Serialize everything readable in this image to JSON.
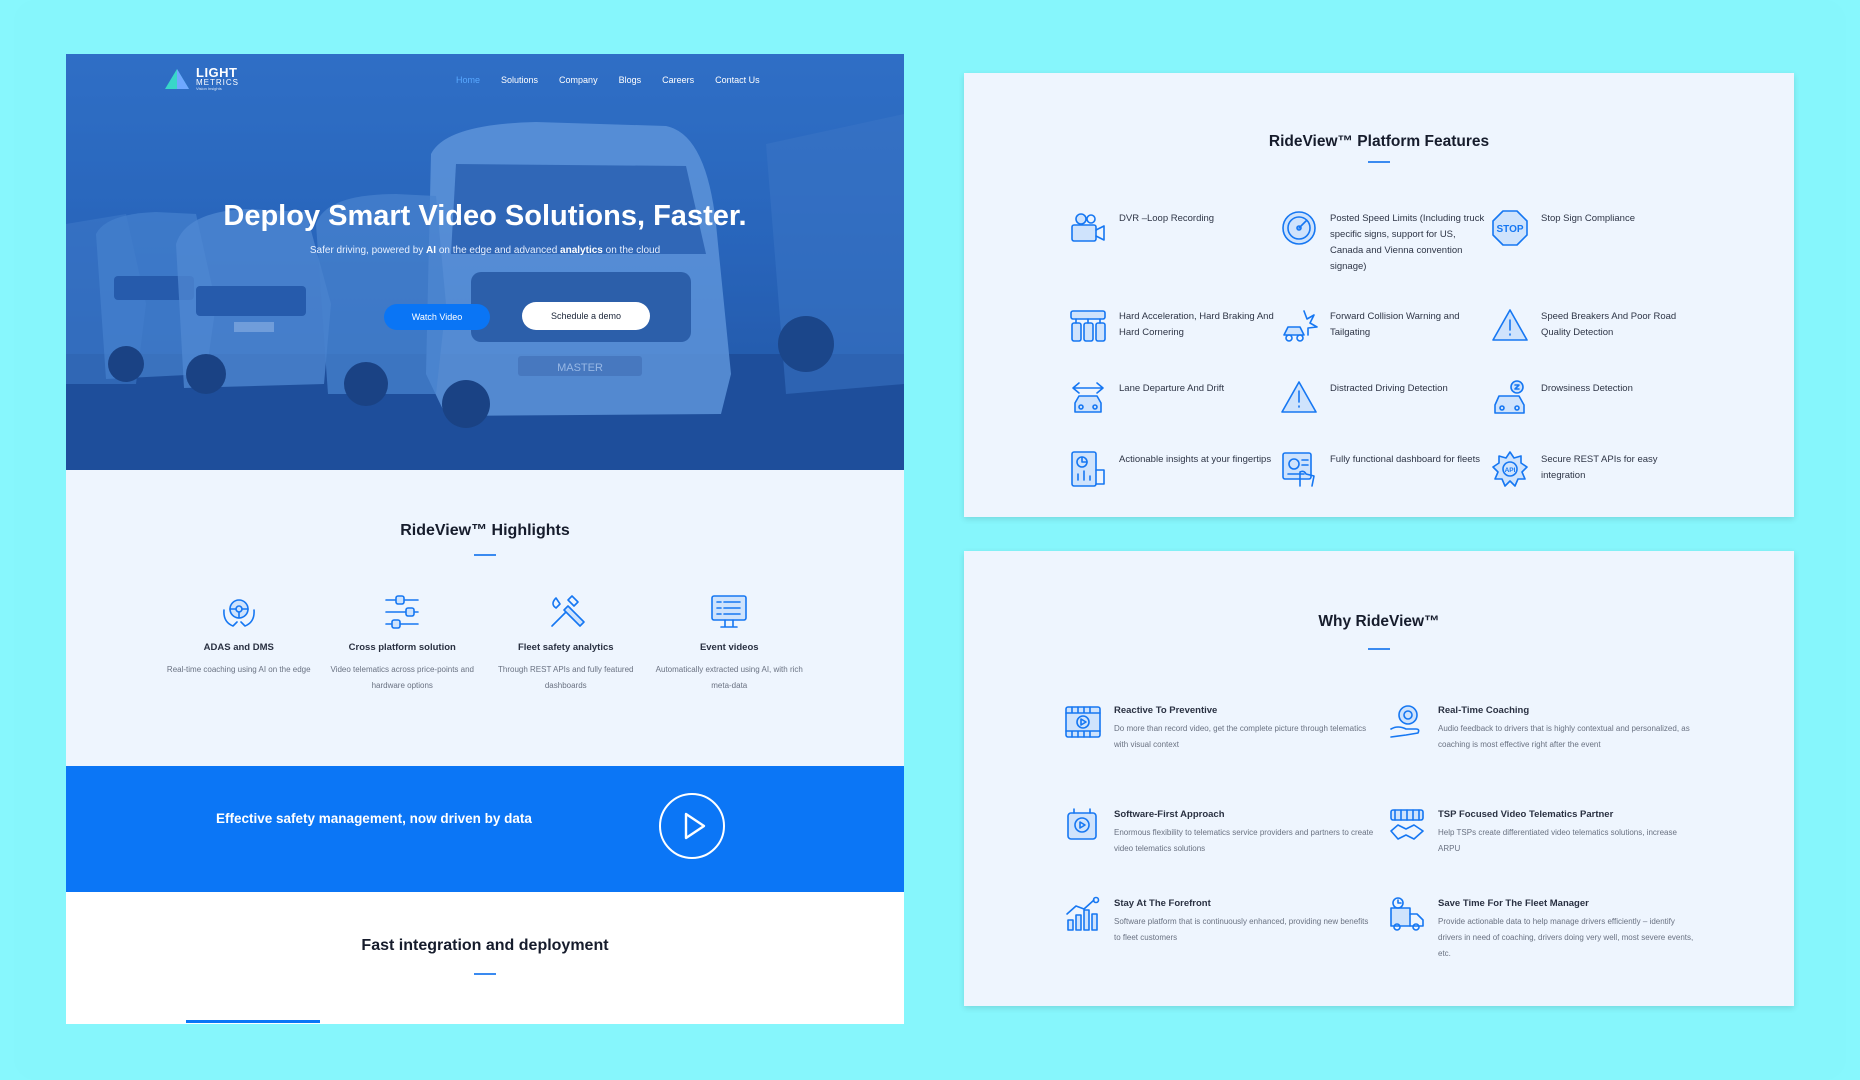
{
  "nav": {
    "logo_main": "LIGHT",
    "logo_sub": "METRICS",
    "logo_tag": "Vision Insights",
    "items": [
      "Home",
      "Solutions",
      "Company",
      "Blogs",
      "Careers",
      "Contact Us"
    ]
  },
  "hero": {
    "title": "Deploy Smart Video Solutions, Faster.",
    "sub_1": "Safer driving, powered by ",
    "sub_ai": "AI",
    "sub_2": " on the edge and advanced ",
    "sub_analytics": "analytics",
    "sub_3": " on the cloud",
    "watch_label": "Watch Video",
    "demo_label": "Schedule a demo",
    "plate_text": "MASTER"
  },
  "highlights": {
    "title": "RideView™ Highlights",
    "items": [
      {
        "title": "ADAS and DMS",
        "desc": "Real-time coaching using AI on the edge",
        "icon": "steering-hands-icon"
      },
      {
        "title": "Cross platform solution",
        "desc": "Video telematics across price-points and hardware options",
        "icon": "sliders-icon"
      },
      {
        "title": "Fleet safety analytics",
        "desc": "Through REST APIs and fully featured dashboards",
        "icon": "tools-icon"
      },
      {
        "title": "Event videos",
        "desc": "Automatically extracted using AI, with rich meta-data",
        "icon": "monitor-list-icon"
      }
    ]
  },
  "cta": {
    "text": "Effective safety management, now driven by data"
  },
  "fast": {
    "title": "Fast integration and deployment"
  },
  "features": {
    "title": "RideView™ Platform Features",
    "items": [
      {
        "label": "DVR –Loop Recording",
        "icon": "video-camera-icon"
      },
      {
        "label": "Posted Speed Limits (Including truck specific signs, support for US, Canada and Vienna convention signage)",
        "icon": "speedometer-icon"
      },
      {
        "label": "Stop Sign Compliance",
        "icon": "stop-sign-icon"
      },
      {
        "label": "Hard Acceleration, Hard Braking And Hard Cornering",
        "icon": "pedals-icon"
      },
      {
        "label": "Forward Collision Warning and Tailgating",
        "icon": "collision-icon"
      },
      {
        "label": "Speed Breakers And Poor Road Quality Detection",
        "icon": "road-warning-icon"
      },
      {
        "label": "Lane Departure And Drift",
        "icon": "lane-departure-icon"
      },
      {
        "label": "Distracted Driving Detection",
        "icon": "warning-triangle-icon"
      },
      {
        "label": "Drowsiness Detection",
        "icon": "drowsy-car-icon"
      },
      {
        "label": "Actionable insights at your fingertips",
        "icon": "report-chart-icon"
      },
      {
        "label": "Fully functional dashboard for fleets",
        "icon": "dashboard-touch-icon"
      },
      {
        "label": "Secure REST APIs for easy integration",
        "icon": "api-gear-icon"
      }
    ]
  },
  "why": {
    "title": "Why RideView™",
    "items": [
      {
        "title": "Reactive To Preventive",
        "desc": "Do more than record video, get the complete picture through telematics with visual context",
        "icon": "film-play-icon"
      },
      {
        "title": "Real-Time Coaching",
        "desc": "Audio feedback to drivers that is highly contextual and personalized, as coaching is most effective right after the event",
        "icon": "coaching-gear-icon"
      },
      {
        "title": "Software-First Approach",
        "desc": "Enormous flexibility to telematics service providers and partners to create video telematics solutions",
        "icon": "software-box-icon"
      },
      {
        "title": "TSP Focused Video Telematics Partner",
        "desc": "Help TSPs create differentiated video telematics solutions, increase ARPU",
        "icon": "handshake-icon"
      },
      {
        "title": "Stay At The Forefront",
        "desc": "Software platform that is continuously enhanced, providing new benefits to fleet customers",
        "icon": "growth-chart-icon"
      },
      {
        "title": "Save Time For The Fleet Manager",
        "desc": "Provide actionable data to help manage drivers efficiently – identify drivers in need of coaching, drivers doing very well, most severe events, etc.",
        "icon": "truck-clock-icon"
      }
    ]
  }
}
